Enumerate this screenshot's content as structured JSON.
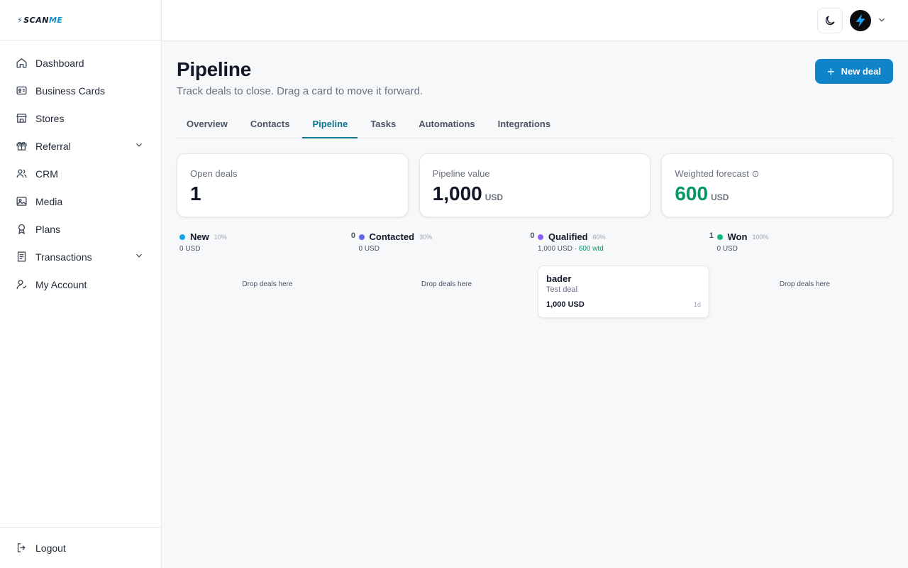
{
  "brand": {
    "logo_prefix": "SCAN",
    "logo_suffix": "ME"
  },
  "sidebar": {
    "items": [
      {
        "label": "Dashboard",
        "icon": "home-icon"
      },
      {
        "label": "Business Cards",
        "icon": "id-card-icon"
      },
      {
        "label": "Stores",
        "icon": "store-icon"
      },
      {
        "label": "Referral",
        "icon": "gift-icon",
        "expandable": true
      },
      {
        "label": "CRM",
        "icon": "users-icon"
      },
      {
        "label": "Media",
        "icon": "image-icon"
      },
      {
        "label": "Plans",
        "icon": "award-icon"
      },
      {
        "label": "Transactions",
        "icon": "receipt-icon",
        "expandable": true
      },
      {
        "label": "My Account",
        "icon": "user-icon"
      }
    ],
    "logout": {
      "label": "Logout",
      "icon": "logout-icon"
    }
  },
  "header": {
    "title": "Pipeline",
    "subtitle": "Track deals to close. Drag a card to move it forward.",
    "new_deal_label": "New deal"
  },
  "tabs": [
    {
      "label": "Overview",
      "active": false
    },
    {
      "label": "Contacts",
      "active": false
    },
    {
      "label": "Pipeline",
      "active": true
    },
    {
      "label": "Tasks",
      "active": false
    },
    {
      "label": "Automations",
      "active": false
    },
    {
      "label": "Integrations",
      "active": false
    }
  ],
  "stats": {
    "open_deals": {
      "label": "Open deals",
      "value": "1"
    },
    "pipeline_value": {
      "label": "Pipeline value",
      "value": "1,000",
      "unit": "USD"
    },
    "weighted_forecast": {
      "label": "Weighted forecast",
      "value": "600",
      "unit": "USD"
    }
  },
  "columns": [
    {
      "name": "New",
      "pct": "10%",
      "count": "0",
      "total": "0 USD",
      "weighted": "",
      "color": "#0ea5e9",
      "drop_text": "Drop deals here"
    },
    {
      "name": "Contacted",
      "pct": "30%",
      "count": "0",
      "total": "0 USD",
      "weighted": "",
      "color": "#6366f1",
      "drop_text": "Drop deals here"
    },
    {
      "name": "Qualified",
      "pct": "60%",
      "count": "1",
      "total": "1,000 USD ·",
      "weighted": "600 wtd",
      "color": "#8b5cf6",
      "drop_text": ""
    },
    {
      "name": "Won",
      "pct": "100%",
      "count": "",
      "total": "0 USD",
      "weighted": "",
      "color": "#10b981",
      "drop_text": "Drop deals here"
    }
  ],
  "deal": {
    "name": "bader",
    "description": "Test deal",
    "value": "1,000 USD",
    "age": "1d"
  },
  "colors": {
    "accent": "#0f84c8",
    "active_tab": "#0e7490",
    "positive": "#059669"
  }
}
